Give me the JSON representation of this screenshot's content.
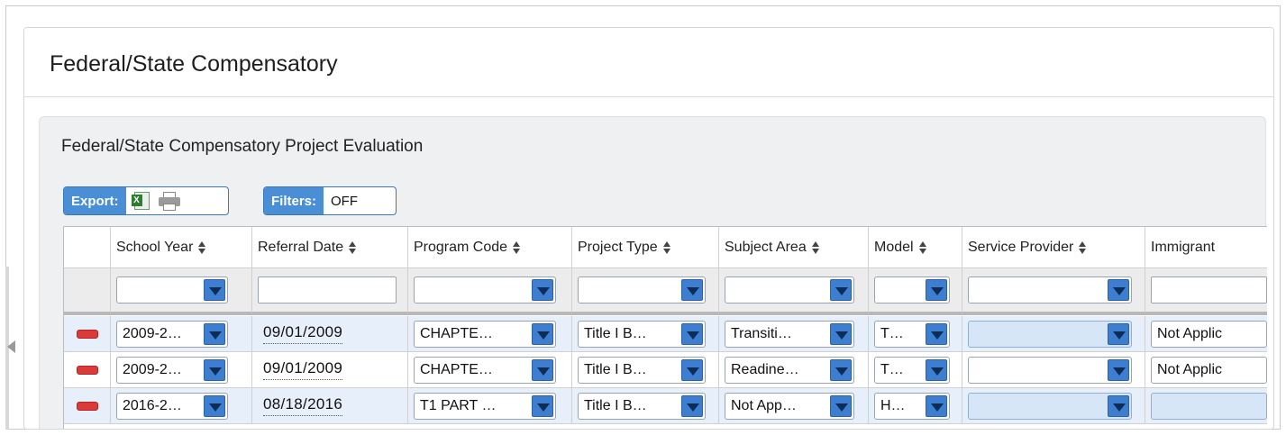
{
  "page": {
    "title": "Federal/State Compensatory",
    "section_title": "Federal/State Compensatory Project Evaluation"
  },
  "toolbar": {
    "export_label": "Export:",
    "filters_label": "Filters:",
    "filters_state": "OFF"
  },
  "columns": [
    {
      "key": "school_year",
      "label": "School Year"
    },
    {
      "key": "referral_date",
      "label": "Referral Date"
    },
    {
      "key": "program_code",
      "label": "Program Code"
    },
    {
      "key": "project_type",
      "label": "Project Type"
    },
    {
      "key": "subject_area",
      "label": "Subject Area"
    },
    {
      "key": "model",
      "label": "Model"
    },
    {
      "key": "service_provider",
      "label": "Service Provider"
    },
    {
      "key": "immigrant",
      "label": "Immigrant"
    }
  ],
  "rows": [
    {
      "school_year": "2009-2…",
      "referral_date": "09/01/2009",
      "program_code": "CHAPTE…",
      "project_type": "Title I B…",
      "subject_area": "Transiti…",
      "model": "T…",
      "service_provider": "",
      "immigrant": "Not Applic"
    },
    {
      "school_year": "2009-2…",
      "referral_date": "09/01/2009",
      "program_code": "CHAPTE…",
      "project_type": "Title I B…",
      "subject_area": "Readine…",
      "model": "T…",
      "service_provider": "",
      "immigrant": "Not Applic"
    },
    {
      "school_year": "2016-2…",
      "referral_date": "08/18/2016",
      "program_code": "T1 PART …",
      "project_type": "Title I B…",
      "subject_area": "Not App…",
      "model": "H…",
      "service_provider": "",
      "immigrant": ""
    }
  ],
  "colors": {
    "accent": "#4a8fd6",
    "dropdown_button": "#3d7ed0",
    "delete_button": "#d93b3b",
    "row_highlight": "#e7f0fa"
  },
  "icons": {
    "excel": "excel-export-icon",
    "print": "printer-icon",
    "delete": "delete-row-icon",
    "sort": "sort-icon",
    "dropdown": "chevron-down-icon",
    "collapse": "collapse-left-icon"
  }
}
